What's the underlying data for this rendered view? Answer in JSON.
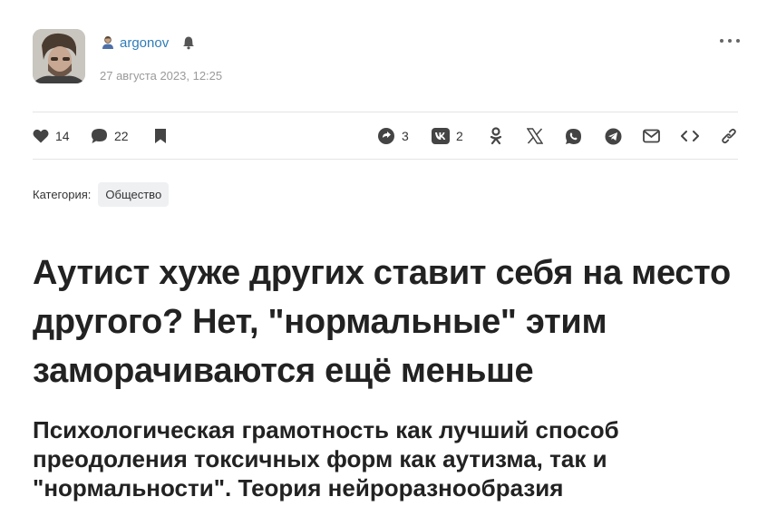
{
  "author": {
    "name": "argonov",
    "date": "27 августа 2023, 12:25"
  },
  "actions": {
    "likes": "14",
    "comments": "22",
    "repost_count": "3",
    "vk_count": "2"
  },
  "category": {
    "label": "Категория:",
    "value": "Общество"
  },
  "article": {
    "title": "Аутист хуже других ставит себя на место другого? Нет, \"нормальные\" этим заморачиваются ещё меньше",
    "subtitle": "Психологическая грамотность как лучший способ преодоления токсичных форм как аутизма, так и \"нормальности\". Теория нейроразнообразия"
  },
  "colors": {
    "link": "#2e7cb9",
    "icon": "#444444",
    "muted": "#9a9a9a",
    "tag_bg": "#eef0f2"
  },
  "icons": [
    "user-icon",
    "bell-icon",
    "more-icon",
    "heart-icon",
    "comment-icon",
    "bookmark-icon",
    "repost-icon",
    "vk-icon",
    "ok-icon",
    "x-icon",
    "whatsapp-icon",
    "telegram-icon",
    "mail-icon",
    "embed-icon",
    "link-icon"
  ]
}
